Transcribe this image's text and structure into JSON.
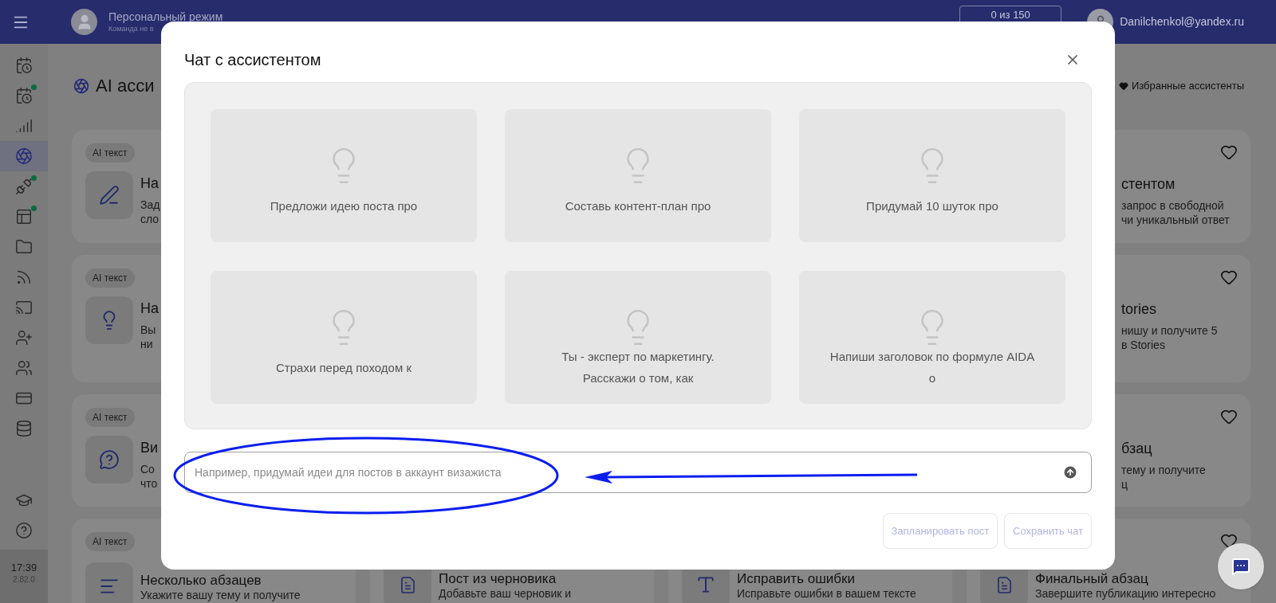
{
  "header": {
    "mode_title": "Персональный режим",
    "mode_subtitle": "Команда не в",
    "counter": "0 из 150",
    "email": "Danilchenkol@yandex.ru"
  },
  "sidebar": {
    "items": [
      {
        "selected": false,
        "notification": false
      },
      {
        "selected": false,
        "notification": true
      },
      {
        "selected": false,
        "notification": false
      },
      {
        "selected": true,
        "notification": false
      },
      {
        "selected": false,
        "notification": true
      },
      {
        "selected": false,
        "notification": true
      },
      {
        "selected": false,
        "notification": false
      },
      {
        "selected": false,
        "notification": false
      },
      {
        "selected": false,
        "notification": false
      },
      {
        "selected": false,
        "notification": false
      },
      {
        "selected": false,
        "notification": false
      },
      {
        "selected": false,
        "notification": false
      },
      {
        "selected": false,
        "notification": false
      }
    ],
    "bottom_items": [
      {
        "selected": false,
        "notification": false
      },
      {
        "selected": false,
        "notification": false
      }
    ],
    "time": "17:39",
    "version": "2.82.0"
  },
  "page": {
    "title": "AI асси",
    "favorites_link": "Избранные ассистенты"
  },
  "left_cards": [
    {
      "badge": "AI текст",
      "title": "На",
      "description": [
        "Зад",
        "сло"
      ]
    },
    {
      "badge": "AI текст",
      "title": "На",
      "description": [
        "Вы",
        "ни"
      ]
    },
    {
      "badge": "AI текст",
      "title": "Ви",
      "description": [
        "Со",
        "что"
      ]
    }
  ],
  "right_cards": [
    {
      "title": "стентом",
      "description": [
        "запрос в свободной",
        "чи уникальный ответ"
      ]
    },
    {
      "title": "tories",
      "description": [
        "нишу и получите 5",
        "в Stories"
      ]
    },
    {
      "title": "бзац",
      "description": [
        "тему и получите",
        "ц"
      ]
    }
  ],
  "bottom_cards": [
    {
      "badge": "AI текст",
      "title": "Несколько абзацев",
      "description": [
        "Укажите вашу тему и получите"
      ]
    },
    {
      "title": "Пост из черновика",
      "description": [
        "Добавьте ваш черновик и"
      ]
    },
    {
      "title": "Исправить ошибки",
      "description": [
        "Исправьте ошибки в вашем тексте"
      ]
    },
    {
      "title": "Финальный абзац",
      "description": [
        "Завершите публикацию интересно"
      ]
    }
  ],
  "dialog": {
    "title": "Чат с ассистентом",
    "prompts": [
      "Предложи идею поста про",
      "Составь контент-план про",
      "Придумай 10 шуток про",
      "Страхи перед походом к",
      "Ты - эксперт по маркетингу.\nРасскажи о том, как",
      "Напиши заголовок по формуле AIDA\nо"
    ],
    "input": {
      "placeholder": "Например, придумай идеи для постов в аккаунт визажиста"
    },
    "buttons": [
      {
        "label": "Запланировать пост",
        "disabled": true
      },
      {
        "label": "Сохранить чат",
        "disabled": true
      }
    ]
  }
}
